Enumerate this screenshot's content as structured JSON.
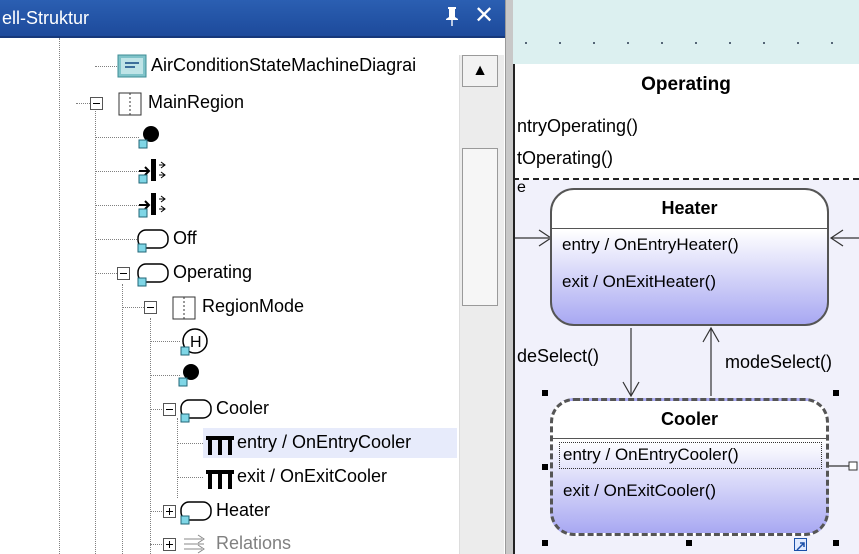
{
  "panel": {
    "title": "ell-Struktur",
    "pin_glyph": "ꟸ",
    "close_glyph": "✕"
  },
  "tree": {
    "items": [
      {
        "label": "AirConditionStateMachineDiagrai",
        "icon": "diagram-icon"
      },
      {
        "label": "MainRegion",
        "icon": "region-icon"
      },
      {
        "label": "",
        "icon": "initial-state-icon"
      },
      {
        "label": "",
        "icon": "entry-point-icon"
      },
      {
        "label": "",
        "icon": "entry-point-icon"
      },
      {
        "label": "Off",
        "icon": "simple-state-icon"
      },
      {
        "label": "Operating",
        "icon": "simple-state-icon"
      },
      {
        "label": "RegionMode",
        "icon": "region-icon"
      },
      {
        "label": "",
        "icon": "history-state-icon",
        "glyph": "H"
      },
      {
        "label": "",
        "icon": "initial-state-icon"
      },
      {
        "label": "Cooler",
        "icon": "simple-state-icon"
      },
      {
        "label": "entry / OnEntryCooler",
        "icon": "activity-icon"
      },
      {
        "label": "exit / OnExitCooler",
        "icon": "activity-icon"
      },
      {
        "label": "Heater",
        "icon": "simple-state-icon"
      },
      {
        "label": "Relations",
        "icon": "relations-icon"
      }
    ],
    "selected": "entry / OnEntryCooler"
  },
  "scrollbar": {
    "up_glyph": "▲"
  },
  "diagram": {
    "operating": {
      "title": "Operating",
      "entry": "ntryOperating()",
      "exit": "tOperating()",
      "body_prefix": "e"
    },
    "heater": {
      "title": "Heater",
      "entry": "entry / OnEntryHeater()",
      "exit": "exit / OnExitHeater()"
    },
    "cooler": {
      "title": "Cooler",
      "entry": "entry / OnEntryCooler()",
      "exit": "exit / OnExitCooler()"
    },
    "transition_left": "deSelect()",
    "transition_right": "modeSelect()"
  },
  "colors": {
    "title_bar": "#1d4a9b",
    "selection": "#e7ebfb",
    "state_fill_bottom": "#a8a8f2",
    "diagram_top": "#dcf0f0"
  }
}
